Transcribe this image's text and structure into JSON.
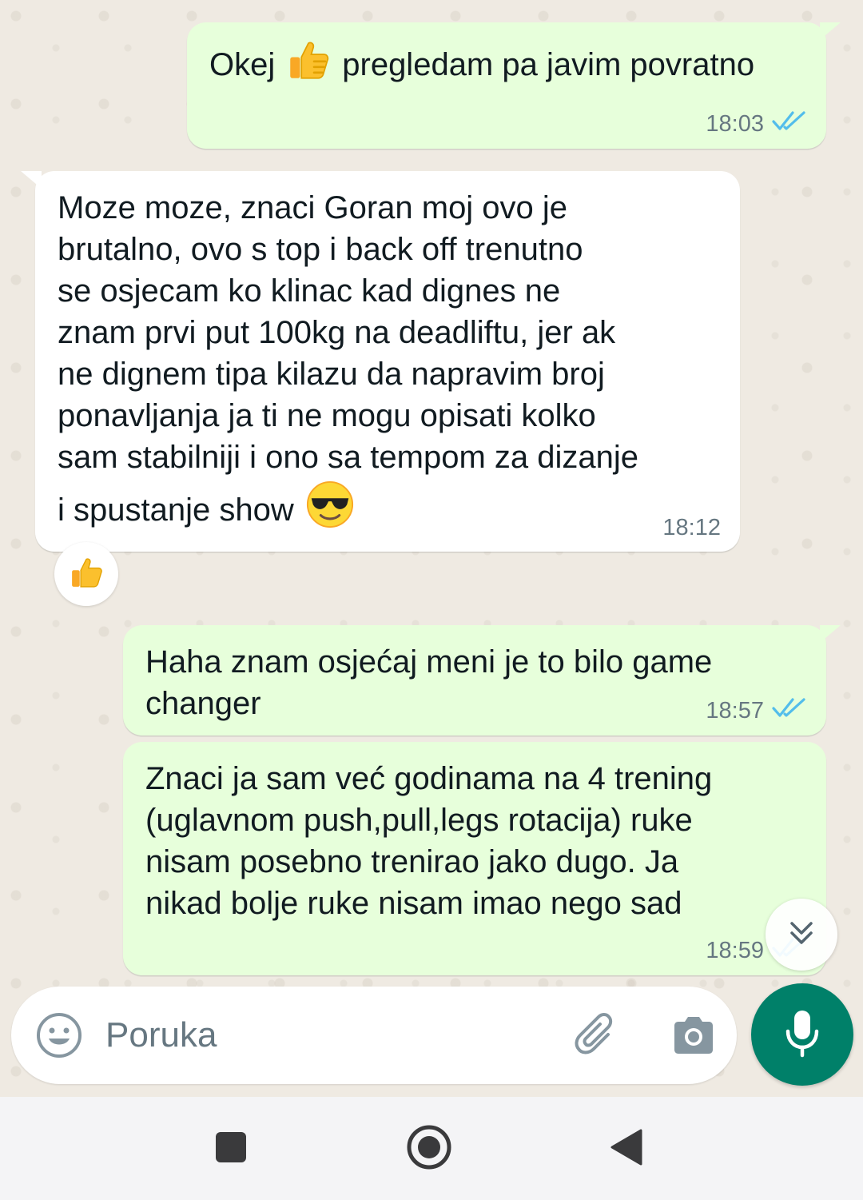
{
  "messages": [
    {
      "direction": "out",
      "text_before": "Okej",
      "emoji": "thumbs-up",
      "text_after": "pregledam pa javim povratno",
      "time": "18:03",
      "status": "read"
    },
    {
      "direction": "in",
      "text": "Moze moze, znaci Goran moj ovo je\nbrutalno, ovo s top i back off trenutno\nse osjecam ko klinac kad dignes ne\nznam prvi put 100kg na deadliftu, jer ak\nne dignem tipa kilazu da napravim broj\nponavljanja ja ti ne mogu opisati kolko\nsam stabilniji i ono sa tempom za dizanje",
      "text_last": "i spustanje show",
      "emoji": "sunglasses-face",
      "time": "18:12",
      "reaction": "thumbs-up"
    },
    {
      "direction": "out",
      "text": "Haha znam osjećaj meni je to bilo game\nchanger",
      "time": "18:57",
      "status": "read"
    },
    {
      "direction": "out",
      "text": "Znaci ja sam već godinama na 4 trening\n(uglavnom push,pull,legs rotacija) ruke\nnisam posebno trenirao jako dugo. Ja\nnikad bolje ruke nisam imao nego sad",
      "time": "18:59",
      "status": "read"
    }
  ],
  "composer": {
    "placeholder": "Poruka",
    "emoji_icon": "smiley-icon",
    "attach_icon": "paperclip-icon",
    "camera_icon": "camera-icon",
    "mic_icon": "mic-icon"
  },
  "colors": {
    "outgoing_bubble": "#e7ffdb",
    "incoming_bubble": "#ffffff",
    "read_ticks": "#53bdeb",
    "mic_button": "#008069",
    "chat_background": "#efeae2"
  },
  "navbar": {
    "recent_icon": "square-icon",
    "home_icon": "circle-icon",
    "back_icon": "triangle-back-icon"
  }
}
